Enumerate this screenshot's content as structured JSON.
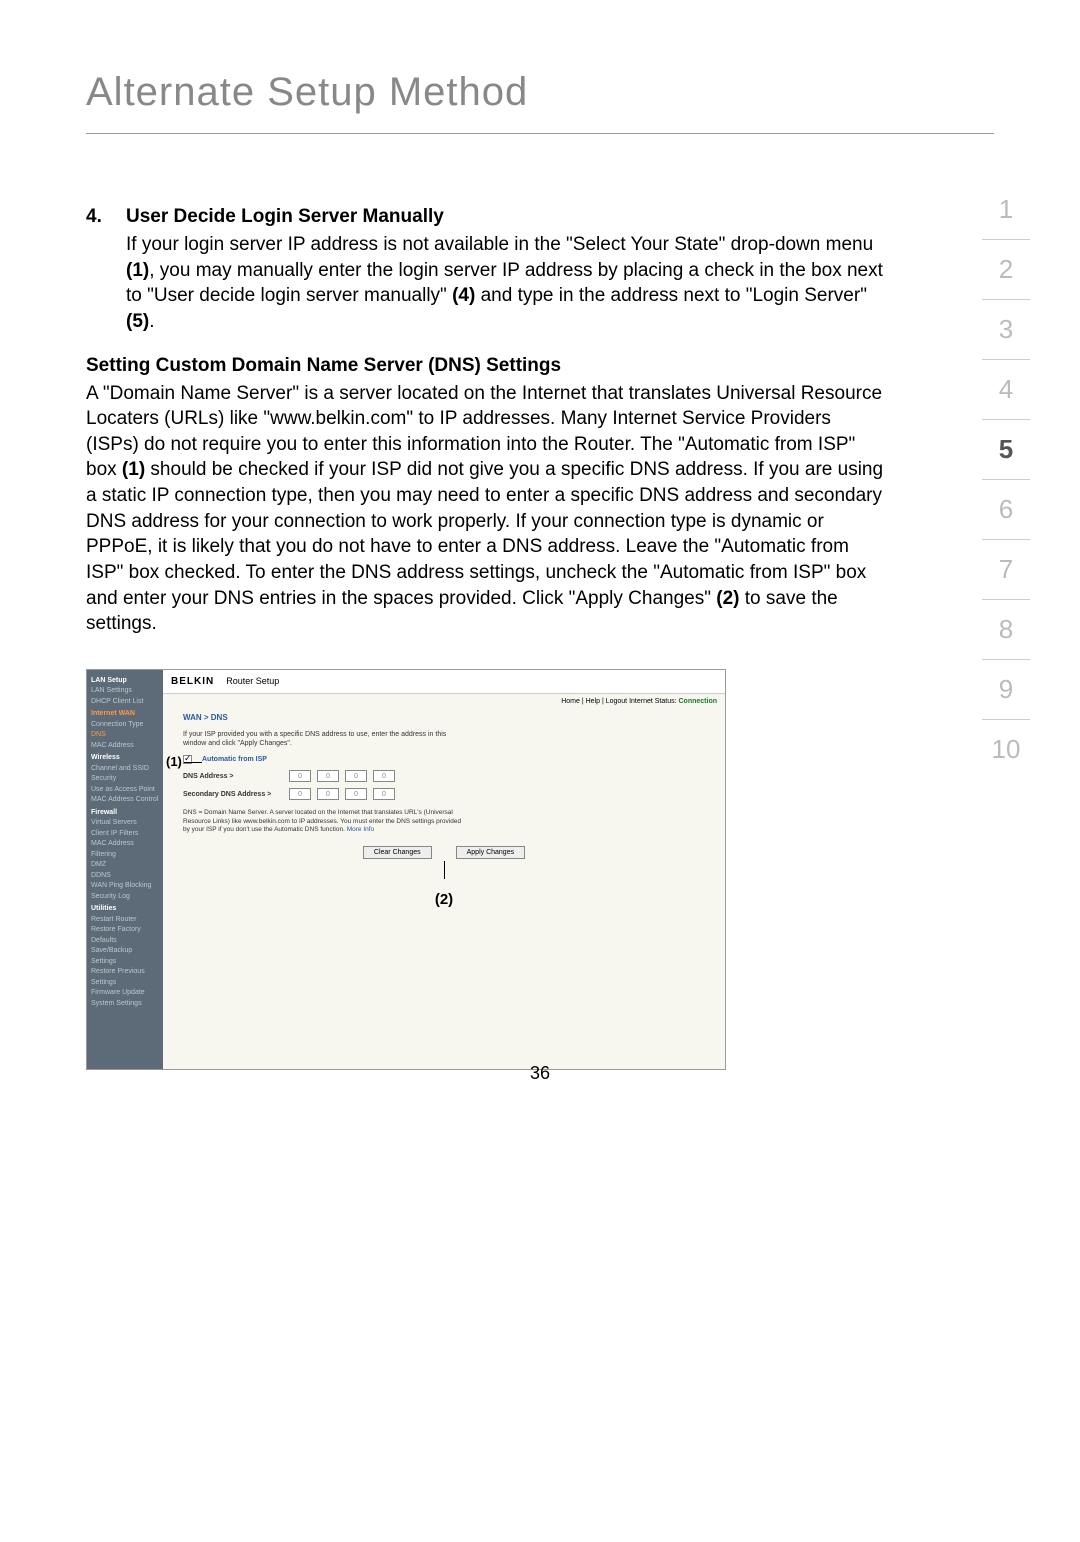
{
  "title": "Alternate Setup Method",
  "page_number": "36",
  "section_label": "section",
  "nav": [
    "1",
    "2",
    "3",
    "4",
    "5",
    "6",
    "7",
    "8",
    "9",
    "10"
  ],
  "nav_active": "5",
  "item4": {
    "num": "4.",
    "heading": "User Decide Login Server Manually",
    "body_pre": "If your login server IP address is not available in the \"Select Your State\" drop-down menu ",
    "c1": "(1)",
    "body_mid1": ", you may manually enter the login server IP address by placing a check in the box next to \"User decide login server manually\" ",
    "c4": "(4)",
    "body_mid2": " and type in the address next to \"Login Server\" ",
    "c5": "(5)",
    "body_end": "."
  },
  "dns_heading": "Setting Custom Domain Name Server (DNS) Settings",
  "dns_body_pre": "A \"Domain Name Server\" is a server located on the Internet that translates Universal Resource Locaters (URLs) like \"www.belkin.com\" to IP addresses. Many Internet Service Providers (ISPs) do not require you to enter this information into the Router. The \"Automatic from ISP\" box ",
  "dns_c1": "(1)",
  "dns_body_mid": " should be checked if your ISP did not give you a specific DNS address. If you are using a static IP connection type, then you may need to enter a specific DNS address and secondary DNS address for your connection to work properly. If your connection type is dynamic or PPPoE, it is likely that you do not have to enter a DNS address. Leave the \"Automatic from ISP\" box checked. To enter the DNS address settings, uncheck the \"Automatic from ISP\" box and enter your DNS entries in the spaces provided. Click \"Apply Changes\" ",
  "dns_c2": "(2)",
  "dns_body_end": " to save the settings.",
  "router": {
    "brand": "BELKIN",
    "setup_title": "Router Setup",
    "topbar_links": "Home | Help | Logout   Internet Status:",
    "status": "Connection",
    "breadcrumb": "WAN > DNS",
    "instruction": "If your ISP provided you with a specific DNS address to use, enter the address in this window and click \"Apply Changes\".",
    "auto_isp": "Automatic from ISP",
    "dns_label": "DNS Address >",
    "sec_dns_label": "Secondary DNS Address >",
    "ip_default": "0",
    "note": "DNS = Domain Name Server. A server located on the Internet that translates URL's (Universal Resource Links) like www.belkin.com to IP addresses. You must enter the DNS settings provided by your ISP if you don't use the Automatic DNS function.",
    "more_info": "More Info",
    "btn_clear": "Clear Changes",
    "btn_apply": "Apply Changes",
    "sidebar": {
      "lan_setup": "LAN Setup",
      "lan_settings": "LAN Settings",
      "dhcp": "DHCP Client List",
      "internet_wan": "Internet WAN",
      "conn_type": "Connection Type",
      "dns": "DNS",
      "mac": "MAC Address",
      "wireless": "Wireless",
      "channel": "Channel and SSID",
      "security": "Security",
      "use_ap": "Use as Access Point",
      "mac_ctrl": "MAC Address Control",
      "firewall": "Firewall",
      "vservers": "Virtual Servers",
      "cip": "Client IP Filters",
      "macfilter": "MAC Address Filtering",
      "dmz": "DMZ",
      "ddns": "DDNS",
      "wanping": "WAN Ping Blocking",
      "seclog": "Security Log",
      "utilities": "Utilities",
      "restart": "Restart Router",
      "restore": "Restore Factory Defaults",
      "backup": "Save/Backup Settings",
      "restoreprev": "Restore Previous Settings",
      "firmware": "Firmware Update",
      "system": "System Settings"
    }
  },
  "callout1": "(1)",
  "callout2": "(2)"
}
